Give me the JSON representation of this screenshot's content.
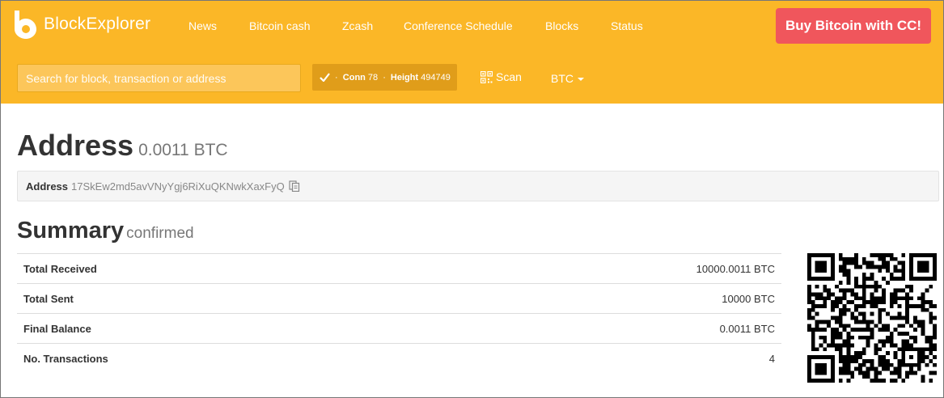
{
  "brand": {
    "name": "BlockExplorer"
  },
  "nav": {
    "items": [
      "News",
      "Bitcoin cash",
      "Zcash",
      "Conference Schedule",
      "Blocks",
      "Status"
    ]
  },
  "buy_button": {
    "label": "Buy Bitcoin with CC!"
  },
  "search": {
    "placeholder": "Search for block, transaction or address"
  },
  "status": {
    "conn_label": "Conn",
    "conn_value": "78",
    "height_label": "Height",
    "height_value": "494749"
  },
  "scan": {
    "label": "Scan"
  },
  "currency": {
    "selected": "BTC"
  },
  "address_header": {
    "title": "Address",
    "balance": "0.0011 BTC"
  },
  "address_box": {
    "label": "Address",
    "value": "17SkEw2md5avVNyYgj6RiXuQKNwkXaxFyQ"
  },
  "summary": {
    "title": "Summary",
    "subtitle": "confirmed",
    "rows": [
      {
        "label": "Total Received",
        "value": "10000.0011 BTC"
      },
      {
        "label": "Total Sent",
        "value": "10000 BTC"
      },
      {
        "label": "Final Balance",
        "value": "0.0011 BTC"
      },
      {
        "label": "No. Transactions",
        "value": "4"
      }
    ]
  },
  "colors": {
    "topbar": "#fbb727",
    "buy_button": "#f0565c",
    "status_pill": "#e09d1a"
  },
  "icons": {
    "logo": "blockexplorer-logo",
    "check": "check-icon",
    "qrcode": "qrcode-icon",
    "copy": "copy-icon",
    "caret": "caret-down-icon"
  }
}
